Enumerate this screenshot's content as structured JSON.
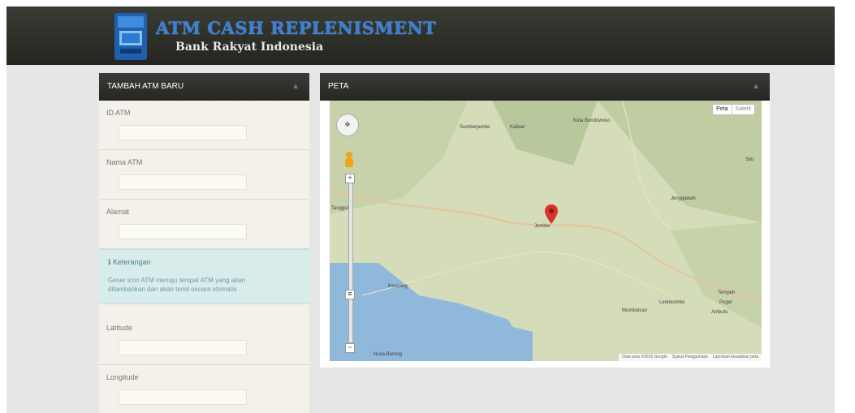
{
  "header": {
    "title": "ATM CASH REPLENISMENT",
    "subtitle": "Bank Rakyat Indonesia"
  },
  "form": {
    "title": "TAMBAH ATM BARU",
    "fields": [
      {
        "label": "ID ATM",
        "value": ""
      },
      {
        "label": "Nama ATM",
        "value": ""
      },
      {
        "label": "Alamat",
        "value": ""
      }
    ],
    "info": {
      "title": "Keterangan",
      "text": "Geser icon ATM menuju tempat ATM yang akan ditambahkan dan akan terisi secara otomatis"
    },
    "coord_fields": [
      {
        "label": "Latitude",
        "value": ""
      },
      {
        "label": "Longitude",
        "value": ""
      }
    ]
  },
  "map": {
    "title": "PETA",
    "type_buttons": [
      "Peta",
      "Satelit"
    ],
    "places": [
      "Kota Bondowoso",
      "Jember",
      "Tempeh",
      "Sumberjambe",
      "Jenggawah",
      "Puger",
      "Kencong",
      "Ambulu",
      "Silo",
      "Ledokombo",
      "Mumbulsari",
      "Kalisat",
      "Tanggul",
      "Nusa Barong"
    ],
    "footer": [
      "Data peta ©2015 Google",
      "Syarat Penggunaan",
      "Laporkan kesalahan peta"
    ]
  },
  "colors": {
    "header_bg": "#2b2c27",
    "brand_blue": "#3a7fd8",
    "form_bg": "#f4f1ea",
    "info_bg": "#d9ecec",
    "marker_red": "#d9342b"
  }
}
